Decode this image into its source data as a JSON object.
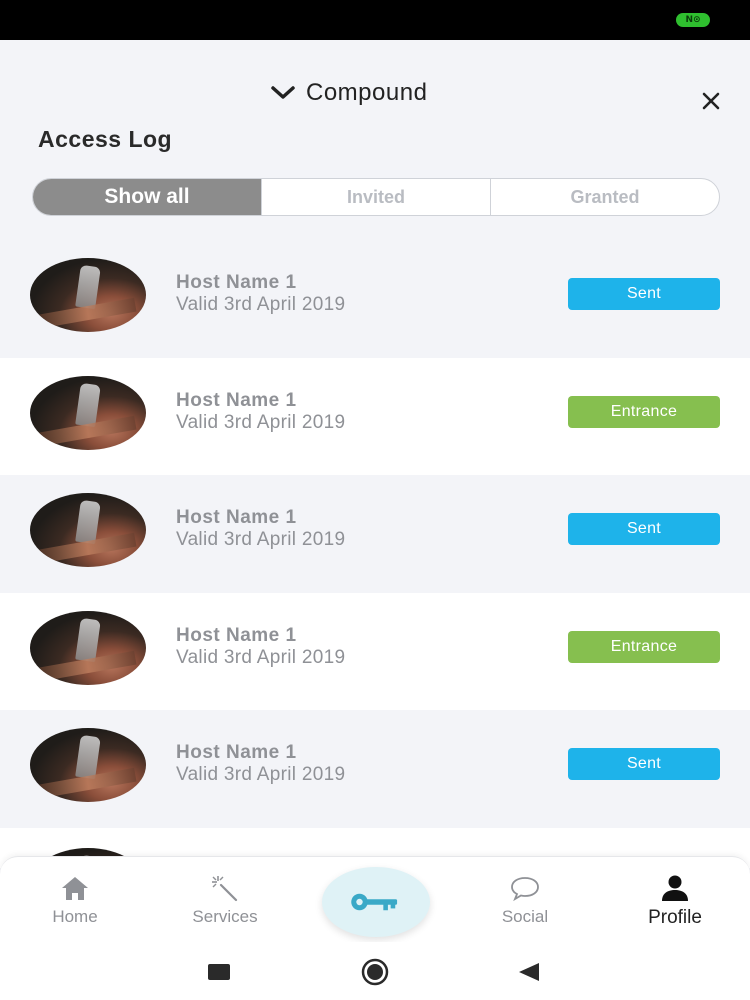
{
  "status_bar": {
    "indicator_text": "N⊙"
  },
  "header": {
    "compound_label": "Compound",
    "title": "Access Log"
  },
  "filters": [
    {
      "label": "Show all",
      "active": true
    },
    {
      "label": "Invited",
      "active": false
    },
    {
      "label": "Granted",
      "active": false
    }
  ],
  "entries": [
    {
      "host": "Host Name 1",
      "valid": "Valid 3rd April 2019",
      "status": "Sent",
      "status_color": "#1eb3ea"
    },
    {
      "host": "Host Name 1",
      "valid": "Valid 3rd April 2019",
      "status": "Entrance",
      "status_color": "#86bf4f"
    },
    {
      "host": "Host Name 1",
      "valid": "Valid 3rd April 2019",
      "status": "Sent",
      "status_color": "#1eb3ea"
    },
    {
      "host": "Host Name 1",
      "valid": "Valid 3rd April 2019",
      "status": "Entrance",
      "status_color": "#86bf4f"
    },
    {
      "host": "Host Name 1",
      "valid": "Valid 3rd April 2019",
      "status": "Sent",
      "status_color": "#1eb3ea"
    }
  ],
  "bottom_nav": {
    "home": "Home",
    "services": "Services",
    "social": "Social",
    "profile": "Profile",
    "key_icon": "key-icon",
    "accent": "#3aa9c7"
  },
  "icons": {
    "home": "home-icon",
    "services": "magic-wand-icon",
    "social": "chat-bubble-icon",
    "profile": "user-icon",
    "close": "close-icon",
    "chevron": "chevron-down-icon"
  }
}
